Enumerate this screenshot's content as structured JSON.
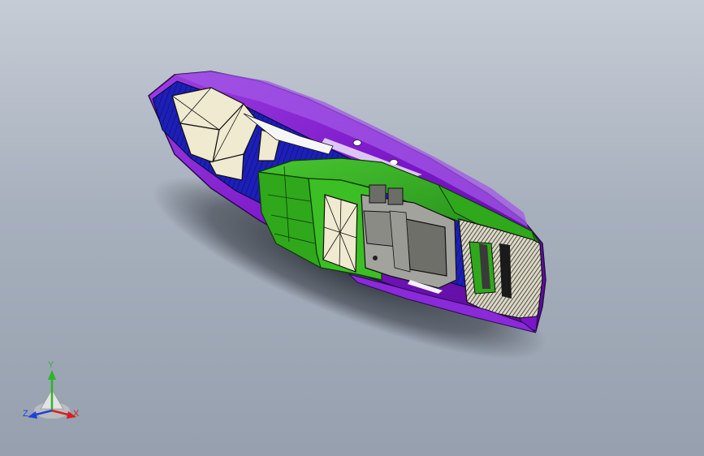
{
  "viewport": {
    "background_top": "#c6ccd5",
    "background_bottom": "#96a0ae",
    "model_colors": {
      "hull_side": "#7a16c8",
      "hull_side_light": "#a04ae0",
      "hull_interior": "#1c1fb8",
      "deck": "#2fa81c",
      "deck_dark": "#1f7a12",
      "panel": "#efead0",
      "machinery": "#8b8b86",
      "hatch": "#3a3a3a",
      "shadow": "#2b3038"
    }
  },
  "triad": {
    "y_label": "Y",
    "x_label": "X",
    "z_label": "Z",
    "y_color": "#2cb52c",
    "x_color": "#d42020",
    "z_color": "#2040d8",
    "icon": "coordinate-triad-icon"
  }
}
